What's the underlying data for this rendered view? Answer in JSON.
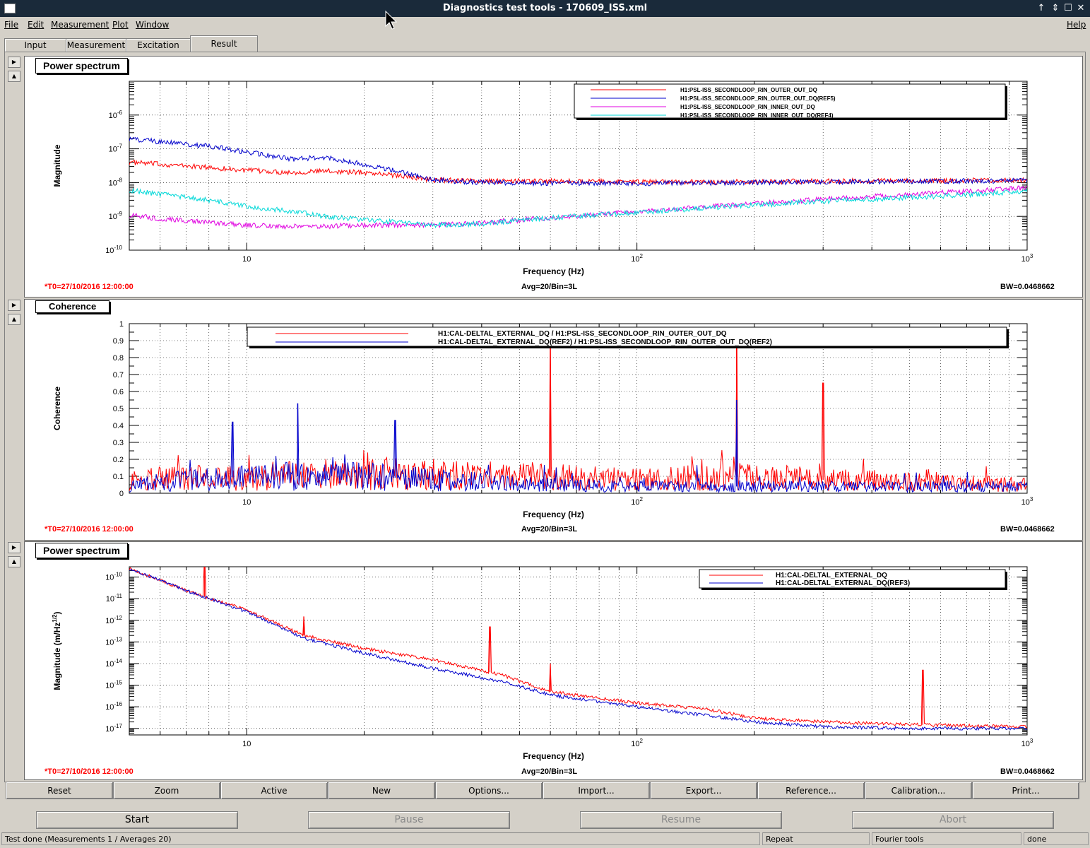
{
  "window": {
    "title": "Diagnostics test tools - 170609_ISS.xml",
    "controls": [
      "↑",
      "⇕",
      "☐",
      "✕"
    ]
  },
  "menu": {
    "items": [
      "File",
      "Edit",
      "Measurement",
      "Plot",
      "Window"
    ],
    "help": "Help"
  },
  "tabs": [
    "Input",
    "Measurement",
    "Excitation",
    "Result"
  ],
  "active_tab": "Result",
  "plots": [
    {
      "title": "Power spectrum",
      "xlabel": "Frequency (Hz)",
      "ylabel": "Magnitude",
      "t0": "*T0=27/10/2016 12:00:00",
      "avg": "Avg=20/Bin=3L",
      "bw": "BW=0.0468662",
      "legend": [
        "H1:PSL-ISS_SECONDLOOP_RIN_OUTER_OUT_DQ",
        "H1:PSL-ISS_SECONDLOOP_RIN_OUTER_OUT_DQ(REF5)",
        "H1:PSL-ISS_SECONDLOOP_RIN_INNER_OUT_DQ",
        "H1:PSL-ISS_SECONDLOOP_RIN_INNER_OUT_DQ(REF4)"
      ]
    },
    {
      "title": "Coherence",
      "xlabel": "Frequency (Hz)",
      "ylabel": "Coherence",
      "t0": "*T0=27/10/2016 12:00:00",
      "avg": "Avg=20/Bin=3L",
      "bw": "BW=0.0468662",
      "legend": [
        "H1:CAL-DELTAL_EXTERNAL_DQ / H1:PSL-ISS_SECONDLOOP_RIN_OUTER_OUT_DQ",
        "H1:CAL-DELTAL_EXTERNAL_DQ(REF2) / H1:PSL-ISS_SECONDLOOP_RIN_OUTER_OUT_DQ(REF2)"
      ]
    },
    {
      "title": "Power spectrum",
      "xlabel": "Frequency (Hz)",
      "ylabel": "Magnitude (m/Hz",
      "ylabel_sup": "1/2",
      "ylabel_end": ")",
      "t0": "*T0=27/10/2016 12:00:00",
      "avg": "Avg=20/Bin=3L",
      "bw": "BW=0.0468662",
      "legend": [
        "H1:CAL-DELTAL_EXTERNAL_DQ",
        "H1:CAL-DELTAL_EXTERNAL_DQ(REF3)"
      ]
    }
  ],
  "toolbar": [
    "Reset",
    "Zoom",
    "Active",
    "New",
    "Options...",
    "Import...",
    "Export...",
    "Reference...",
    "Calibration...",
    "Print..."
  ],
  "controls": {
    "start": "Start",
    "pause": "Pause",
    "resume": "Resume",
    "abort": "Abort"
  },
  "status": {
    "message": "Test done (Measurements 1 / Averages 20)",
    "mode": "Repeat",
    "tool": "Fourier tools",
    "state": "done"
  },
  "colors": {
    "red": "#ff0000",
    "blue": "#0000cc",
    "magenta": "#e000e0",
    "cyan": "#00d8d8",
    "t0_text": "#ff0000"
  },
  "chart_data": [
    {
      "type": "line",
      "title": "Power spectrum",
      "xlabel": "Frequency (Hz)",
      "ylabel": "Magnitude",
      "xscale": "log",
      "yscale": "log",
      "xlim": [
        5,
        1000
      ],
      "ylim": [
        1e-10,
        1e-05
      ],
      "x_ticks": [
        "10",
        "10^2",
        "10^3"
      ],
      "y_ticks": [
        "10^-10",
        "10^-9",
        "10^-8",
        "10^-7",
        "10^-6"
      ],
      "legend_position": "top-right",
      "grid": true,
      "series": [
        {
          "name": "H1:PSL-ISS_SECONDLOOP_RIN_OUTER_OUT_DQ",
          "color": "#ff0000",
          "x": [
            5,
            6,
            8,
            10,
            13,
            16,
            20,
            25,
            30,
            40,
            60,
            100,
            180,
            300,
            600,
            1000
          ],
          "y": [
            4e-08,
            3.5e-08,
            2.8e-08,
            2.3e-08,
            2e-08,
            2.2e-08,
            2e-08,
            1.6e-08,
            1.2e-08,
            1.1e-08,
            1.1e-08,
            1.05e-08,
            1.05e-08,
            1.1e-08,
            1.15e-08,
            1.2e-08
          ]
        },
        {
          "name": "H1:PSL-ISS_SECONDLOOP_RIN_OUTER_OUT_DQ(REF5)",
          "color": "#0000cc",
          "x": [
            5,
            6,
            8,
            10,
            13,
            16,
            20,
            25,
            30,
            40,
            60,
            100,
            180,
            300,
            600,
            1000
          ],
          "y": [
            2e-07,
            1.6e-07,
            1.2e-07,
            8e-08,
            5e-08,
            5.5e-08,
            3.5e-08,
            2e-08,
            1.2e-08,
            1e-08,
            9.5e-09,
            9.5e-09,
            1e-08,
            1.05e-08,
            1.1e-08,
            1.15e-08
          ]
        },
        {
          "name": "H1:PSL-ISS_SECONDLOOP_RIN_INNER_OUT_DQ",
          "color": "#e000e0",
          "x": [
            5,
            6,
            8,
            10,
            13,
            16,
            20,
            25,
            30,
            40,
            60,
            100,
            180,
            300,
            600,
            1000
          ],
          "y": [
            1.1e-09,
            8.5e-10,
            6.5e-10,
            5.5e-10,
            5e-10,
            5e-10,
            5.5e-10,
            5.5e-10,
            5.5e-10,
            6.5e-10,
            9e-10,
            1.4e-09,
            2.2e-09,
            3.2e-09,
            5e-09,
            7e-09
          ]
        },
        {
          "name": "H1:PSL-ISS_SECONDLOOP_RIN_INNER_OUT_DQ(REF4)",
          "color": "#00d8d8",
          "x": [
            5,
            6,
            8,
            10,
            13,
            16,
            20,
            25,
            30,
            40,
            60,
            100,
            180,
            300,
            600,
            1000
          ],
          "y": [
            6e-09,
            4.5e-09,
            3e-09,
            2e-09,
            1.4e-09,
            1e-09,
            8e-10,
            6.5e-10,
            5.5e-10,
            6e-10,
            9e-10,
            1.3e-09,
            2e-09,
            2.8e-09,
            4e-09,
            5.5e-09
          ]
        }
      ]
    },
    {
      "type": "line",
      "title": "Coherence",
      "xlabel": "Frequency (Hz)",
      "ylabel": "Coherence",
      "xscale": "log",
      "xlim": [
        5,
        1000
      ],
      "ylim": [
        0,
        1
      ],
      "x_ticks": [
        "10",
        "10^2",
        "10^3"
      ],
      "y_ticks": [
        "0",
        "0.1",
        "0.2",
        "0.3",
        "0.4",
        "0.5",
        "0.6",
        "0.7",
        "0.8",
        "0.9",
        "1"
      ],
      "legend_position": "top",
      "grid": true,
      "series": [
        {
          "name": "H1:CAL-DELTAL_EXTERNAL_DQ / H1:PSL-ISS_SECONDLOOP_RIN_OUTER_OUT_DQ",
          "color": "#ff0000",
          "x": [
            5,
            10,
            20,
            60,
            100,
            180,
            300,
            1000
          ],
          "y": [
            0.08,
            0.1,
            0.12,
            0.1,
            0.08,
            0.1,
            0.08,
            0.05
          ],
          "peaks": [
            {
              "x": 60,
              "y": 0.98
            },
            {
              "x": 180,
              "y": 0.98
            },
            {
              "x": 300,
              "y": 0.65
            }
          ]
        },
        {
          "name": "H1:CAL-DELTAL_EXTERNAL_DQ(REF2) / H1:PSL-ISS_SECONDLOOP_RIN_OUTER_OUT_DQ(REF2)",
          "color": "#0000cc",
          "x": [
            5,
            10,
            20,
            60,
            100,
            180,
            300,
            1000
          ],
          "y": [
            0.05,
            0.1,
            0.1,
            0.05,
            0.04,
            0.04,
            0.04,
            0.04
          ],
          "peaks": [
            {
              "x": 9.2,
              "y": 0.42
            },
            {
              "x": 13.5,
              "y": 0.53
            },
            {
              "x": 24,
              "y": 0.43
            },
            {
              "x": 180,
              "y": 0.55
            }
          ]
        }
      ]
    },
    {
      "type": "line",
      "title": "Power spectrum",
      "xlabel": "Frequency (Hz)",
      "ylabel": "Magnitude (m/Hz^1/2)",
      "xscale": "log",
      "yscale": "log",
      "xlim": [
        5,
        1000
      ],
      "ylim": [
        5e-18,
        3e-10
      ],
      "x_ticks": [
        "10",
        "10^2",
        "10^3"
      ],
      "y_ticks": [
        "10^-17",
        "10^-16",
        "10^-15",
        "10^-14",
        "10^-13",
        "10^-12",
        "10^-11",
        "10^-10"
      ],
      "legend_position": "top-right",
      "grid": true,
      "series": [
        {
          "name": "H1:CAL-DELTAL_EXTERNAL_DQ",
          "color": "#ff0000",
          "x": [
            5,
            6,
            7.5,
            10,
            14,
            20,
            30,
            45,
            60,
            100,
            150,
            200,
            300,
            500,
            1000
          ],
          "y": [
            2.5e-10,
            7e-11,
            1.5e-11,
            3e-12,
            2e-13,
            5e-14,
            1.5e-14,
            3e-15,
            5e-16,
            1.5e-16,
            8e-17,
            3e-17,
            2e-17,
            1.5e-17,
            1.2e-17
          ],
          "peaks": [
            {
              "x": 7.8,
              "y": 3e-10
            },
            {
              "x": 14,
              "y": 1.5e-12
            },
            {
              "x": 42,
              "y": 5e-13
            },
            {
              "x": 60,
              "y": 1e-14
            },
            {
              "x": 540,
              "y": 5e-15
            }
          ]
        },
        {
          "name": "H1:CAL-DELTAL_EXTERNAL_DQ(REF3)",
          "color": "#0000cc",
          "x": [
            5,
            6,
            7.5,
            10,
            14,
            20,
            30,
            45,
            60,
            100,
            150,
            200,
            300,
            500,
            1000
          ],
          "y": [
            2.5e-10,
            7e-11,
            1.5e-11,
            2.5e-12,
            1.5e-13,
            3e-14,
            6e-15,
            1.5e-15,
            3.5e-16,
            1e-16,
            4e-17,
            2e-17,
            1.2e-17,
            1e-17,
            1e-17
          ]
        }
      ]
    }
  ]
}
